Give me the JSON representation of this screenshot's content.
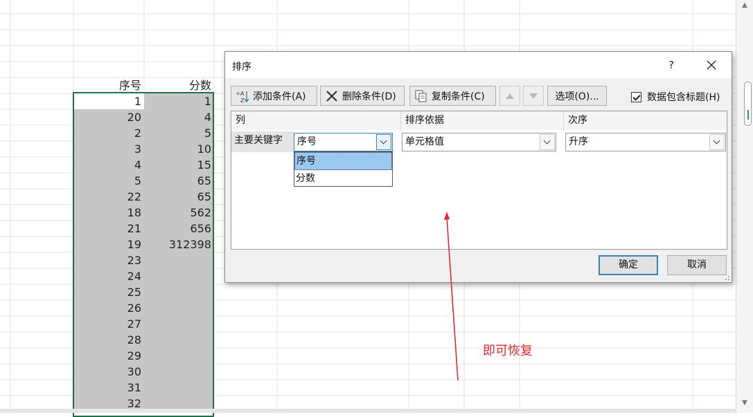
{
  "sheet": {
    "header_a": "序号",
    "header_b": "分数",
    "col_a": [
      "1",
      "20",
      "2",
      "3",
      "4",
      "5",
      "22",
      "18",
      "21",
      "19",
      "23",
      "24",
      "25",
      "26",
      "27",
      "28",
      "29",
      "30",
      "31",
      "32"
    ],
    "col_b": [
      "1",
      "4",
      "5",
      "10",
      "15",
      "65",
      "65",
      "562",
      "656",
      "312398",
      "",
      "",
      "",
      "",
      "",
      "",
      "",
      "",
      "",
      ""
    ]
  },
  "dialog": {
    "title": "排序",
    "help": "?",
    "toolbar": {
      "add": "添加条件(A)",
      "delete": "删除条件(D)",
      "copy": "复制条件(C)",
      "options": "选项(O)...",
      "has_header": "数据包含标题(H)"
    },
    "table": {
      "col_header": "列",
      "basis_header": "排序依据",
      "order_header": "次序",
      "primary_label": "主要关键字",
      "column_value": "序号",
      "basis_value": "单元格值",
      "order_value": "升序",
      "dropdown_options": [
        "序号",
        "分数"
      ]
    },
    "ok": "确定",
    "cancel": "取消"
  },
  "annotation": "即可恢复",
  "colors": {
    "selection": "#c6c6c6",
    "selection_border": "#1e7145",
    "annotation": "#e0282e",
    "highlight": "#9bc8f0"
  }
}
